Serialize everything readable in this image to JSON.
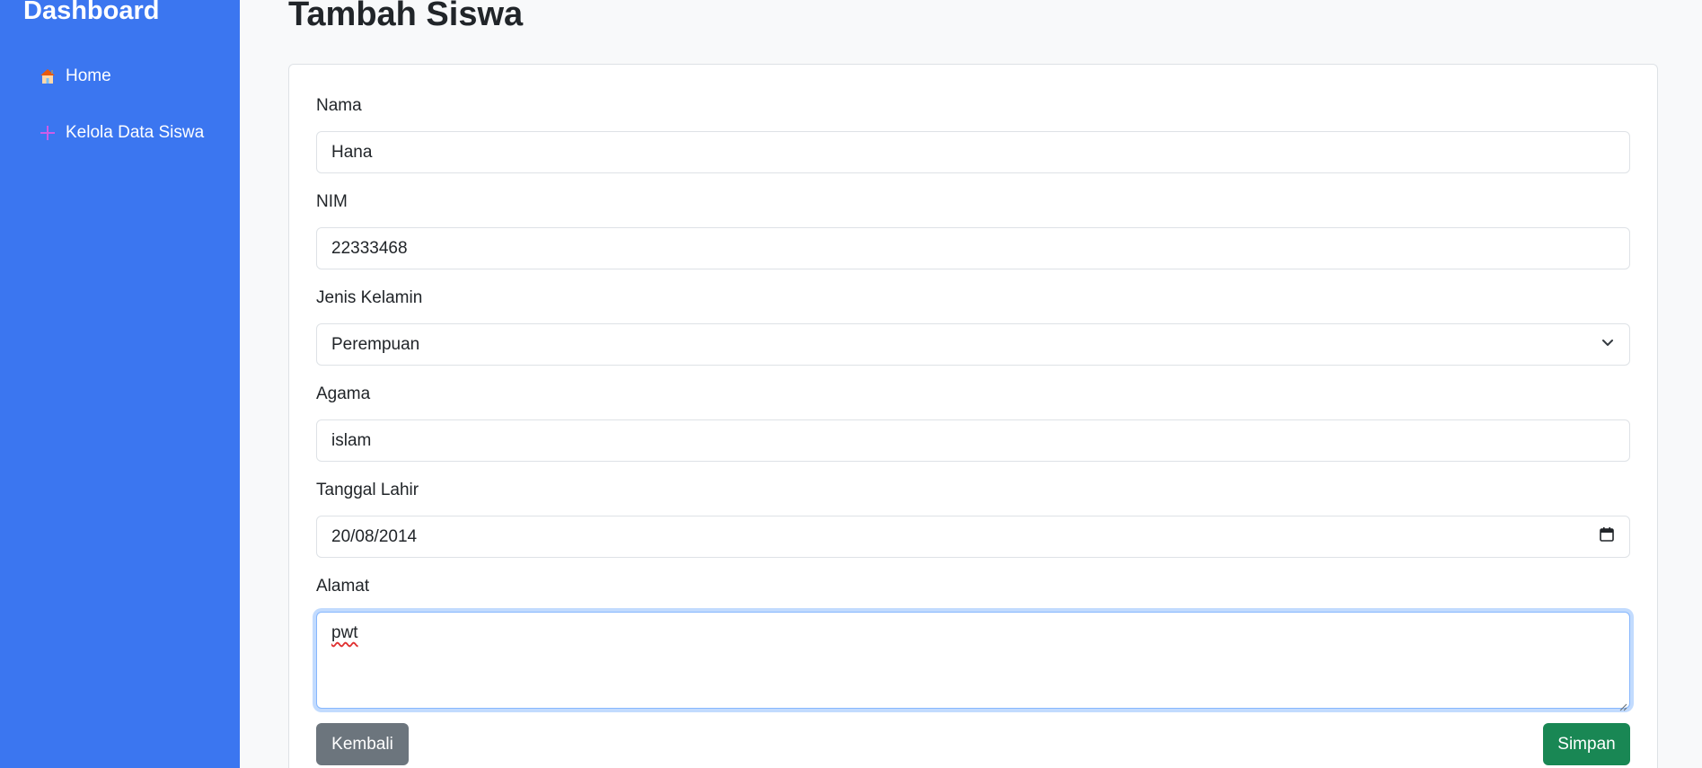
{
  "sidebar": {
    "title": "Dashboard",
    "items": [
      {
        "label": "Home",
        "icon": "house-icon"
      },
      {
        "label": "Kelola Data Siswa",
        "icon": "plus-icon"
      }
    ]
  },
  "main": {
    "title": "Tambah Siswa"
  },
  "form": {
    "nama": {
      "label": "Nama",
      "value": "Hana"
    },
    "nim": {
      "label": "NIM",
      "value": "22333468"
    },
    "jenis_kelamin": {
      "label": "Jenis Kelamin",
      "value": "Perempuan"
    },
    "agama": {
      "label": "Agama",
      "value": "islam"
    },
    "tanggal_lahir": {
      "label": "Tanggal Lahir",
      "value": "20/08/2014"
    },
    "alamat": {
      "label": "Alamat",
      "value": "pwt"
    }
  },
  "buttons": {
    "back": "Kembali",
    "save": "Simpan"
  },
  "colors": {
    "sidebar": "#3b76f0",
    "back_button": "#6c757d",
    "save_button": "#198754"
  }
}
